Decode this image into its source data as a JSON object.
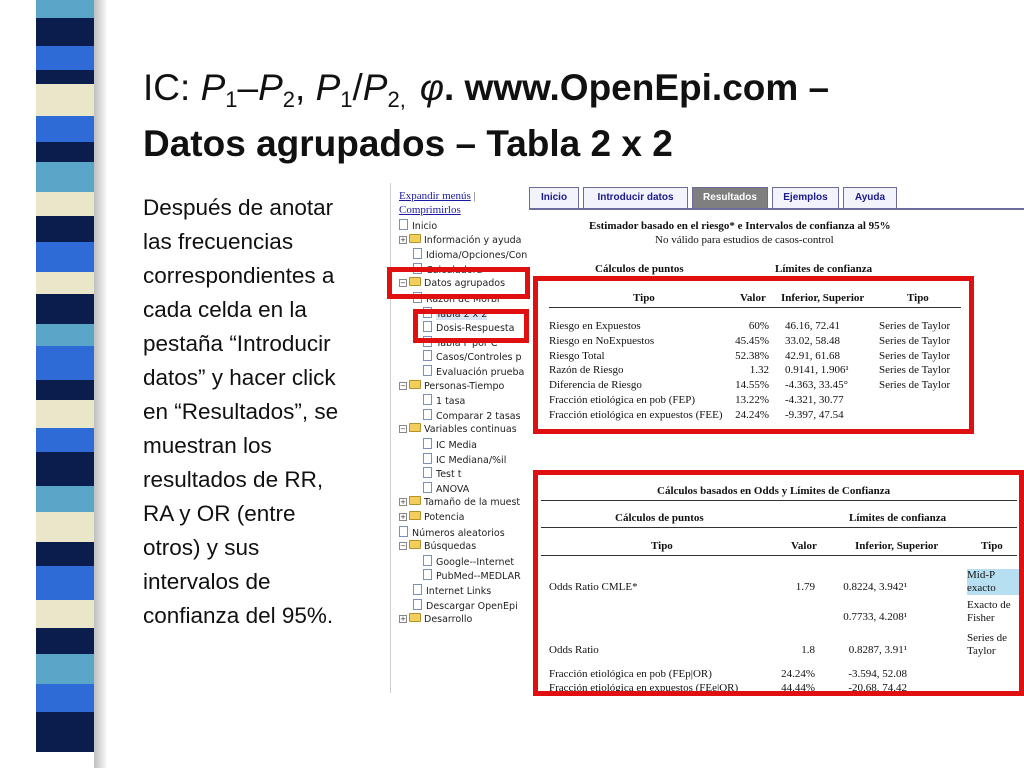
{
  "colors": {
    "accent_red": "#e01010",
    "stripe_dark": "#0a1d4d",
    "stripe_blue": "#2e6bd6",
    "stripe_yellow": "#e9e6c9",
    "stripe_teal": "#5aa6c8"
  },
  "title": {
    "ic": "IC: ",
    "p1a": "P",
    "sub1a": "1",
    "dash": "–",
    "p2a": "P",
    "sub2a": "2",
    "comma1": ", ",
    "p1b": "P",
    "sub1b": "1",
    "slash": "/",
    "p2b": "P",
    "sub2b": "2,",
    "phi": "φ",
    "url": ". www.OpenEpi.com –",
    "line2": "Datos agrupados – Tabla 2 x 2"
  },
  "body_text": "Después de anotar las frecuencias correspondientes a cada celda en la pestaña “Introducir datos” y hacer click en “Resultados”, se muestran los resultados de RR, RA y OR (entre otros) y sus intervalos de confianza del 95%.",
  "nav": {
    "expand": "Expandir menús",
    "sep": "|",
    "collapse": "Comprimirlos",
    "tree": [
      {
        "label": "Inicio",
        "icon": "doc-icon"
      },
      {
        "label": "Información y ayuda",
        "icon": "folder-icon",
        "exp": "+"
      },
      {
        "label": "Idioma/Opciones/Con",
        "icon": "doc-icon"
      },
      {
        "label": "Calculadora",
        "icon": "doc-icon"
      },
      {
        "label": "Datos agrupados",
        "icon": "folder-icon",
        "exp": "–"
      },
      {
        "label": "Razón de Morbi",
        "icon": "doc-icon"
      },
      {
        "label": "Tabla 2 x 2",
        "icon": "doc-icon"
      },
      {
        "label": "Dosis-Respuesta",
        "icon": "doc-icon"
      },
      {
        "label": "Tabla F por C",
        "icon": "doc-icon"
      },
      {
        "label": "Casos/Controles p",
        "icon": "doc-icon"
      },
      {
        "label": "Evaluación prueba",
        "icon": "doc-icon"
      },
      {
        "label": "Personas-Tiempo",
        "icon": "folder-icon",
        "exp": "–"
      },
      {
        "label": "1 tasa",
        "icon": "doc-icon"
      },
      {
        "label": "Comparar 2 tasas",
        "icon": "doc-icon"
      },
      {
        "label": "Variables continuas",
        "icon": "folder-icon",
        "exp": "–"
      },
      {
        "label": "IC Media",
        "icon": "doc-icon"
      },
      {
        "label": "IC Mediana/%il",
        "icon": "doc-icon"
      },
      {
        "label": "Test t",
        "icon": "doc-icon"
      },
      {
        "label": "ANOVA",
        "icon": "doc-icon"
      },
      {
        "label": "Tamaño de la muest",
        "icon": "folder-icon",
        "exp": "+"
      },
      {
        "label": "Potencia",
        "icon": "folder-icon",
        "exp": "+"
      },
      {
        "label": "Números aleatorios",
        "icon": "doc-icon"
      },
      {
        "label": "Búsquedas",
        "icon": "folder-icon",
        "exp": "–"
      },
      {
        "label": "Google--Internet",
        "icon": "doc-icon"
      },
      {
        "label": "PubMed--MEDLAR",
        "icon": "doc-icon"
      },
      {
        "label": "Internet Links",
        "icon": "doc-icon"
      },
      {
        "label": "Descargar OpenEpi",
        "icon": "doc-icon"
      },
      {
        "label": "Desarrollo",
        "icon": "folder-icon",
        "exp": "+"
      }
    ]
  },
  "tabs": [
    "Inicio",
    "Introducir datos",
    "Resultados",
    "Ejemplos",
    "Ayuda"
  ],
  "risk": {
    "heading": "Estimador basado en el riesgo* e Intervalos de confianza al 95%",
    "note": "No válido para estudios de casos-control",
    "points_header": "Cálculos de puntos",
    "limits_header": "Límites de confianza",
    "col_tipo": "Tipo",
    "col_valor": "Valor",
    "col_inf_sup": "Inferior, Superior",
    "col_tipo2": "Tipo",
    "rows": [
      {
        "tipo": "Riesgo en Expuestos",
        "valor": "60%",
        "ic": "46.16, 72.41",
        "metodo": "Series de Taylor"
      },
      {
        "tipo": "Riesgo en NoExpuestos",
        "valor": "45.45%",
        "ic": "33.02, 58.48",
        "metodo": "Series de Taylor"
      },
      {
        "tipo": "Riesgo Total",
        "valor": "52.38%",
        "ic": "42.91, 61.68",
        "metodo": "Series de Taylor"
      },
      {
        "tipo": "Razón de Riesgo",
        "valor": "1.32",
        "ic": "0.9141, 1.906¹",
        "metodo": "Series de Taylor"
      },
      {
        "tipo": "Diferencia de Riesgo",
        "valor": "14.55%",
        "ic": "-4.363, 33.45°",
        "metodo": "Series de Taylor"
      },
      {
        "tipo": "Fracción etiológica en pob (FEP)",
        "valor": "13.22%",
        "ic": "-4.321, 30.77",
        "metodo": ""
      },
      {
        "tipo": "Fracción etiológica en expuestos (FEE)",
        "valor": "24.24%",
        "ic": "-9.397, 47.54",
        "metodo": ""
      }
    ]
  },
  "odds": {
    "heading": "Cálculos basados en Odds y Límites de Confianza",
    "points_header": "Cálculos de puntos",
    "limits_header": "Límites de confianza",
    "col_tipo": "Tipo",
    "col_valor": "Valor",
    "col_inf_sup": "Inferior, Superior",
    "col_tipo2": "Tipo",
    "rows": [
      {
        "tipo": "Odds Ratio CMLE*",
        "valor": "1.79",
        "ic": "0.8224, 3.942¹",
        "metodo": "Mid-P exacto"
      },
      {
        "tipo": "",
        "valor": "",
        "ic": "0.7733, 4.208¹",
        "metodo": "Exacto de Fisher"
      },
      {
        "tipo": "Odds Ratio",
        "valor": "1.8",
        "ic": "0.8287, 3.91¹",
        "metodo": "Series de Taylor"
      },
      {
        "tipo": "Fracción etiológica en pob (FEp|OR)",
        "valor": "24.24%",
        "ic": "-3.594, 52.08",
        "metodo": ""
      },
      {
        "tipo": "Fracción etiológica en expuestos (FEe|OR)",
        "valor": "44.44%",
        "ic": "-20.68, 74.42",
        "metodo": ""
      }
    ]
  }
}
